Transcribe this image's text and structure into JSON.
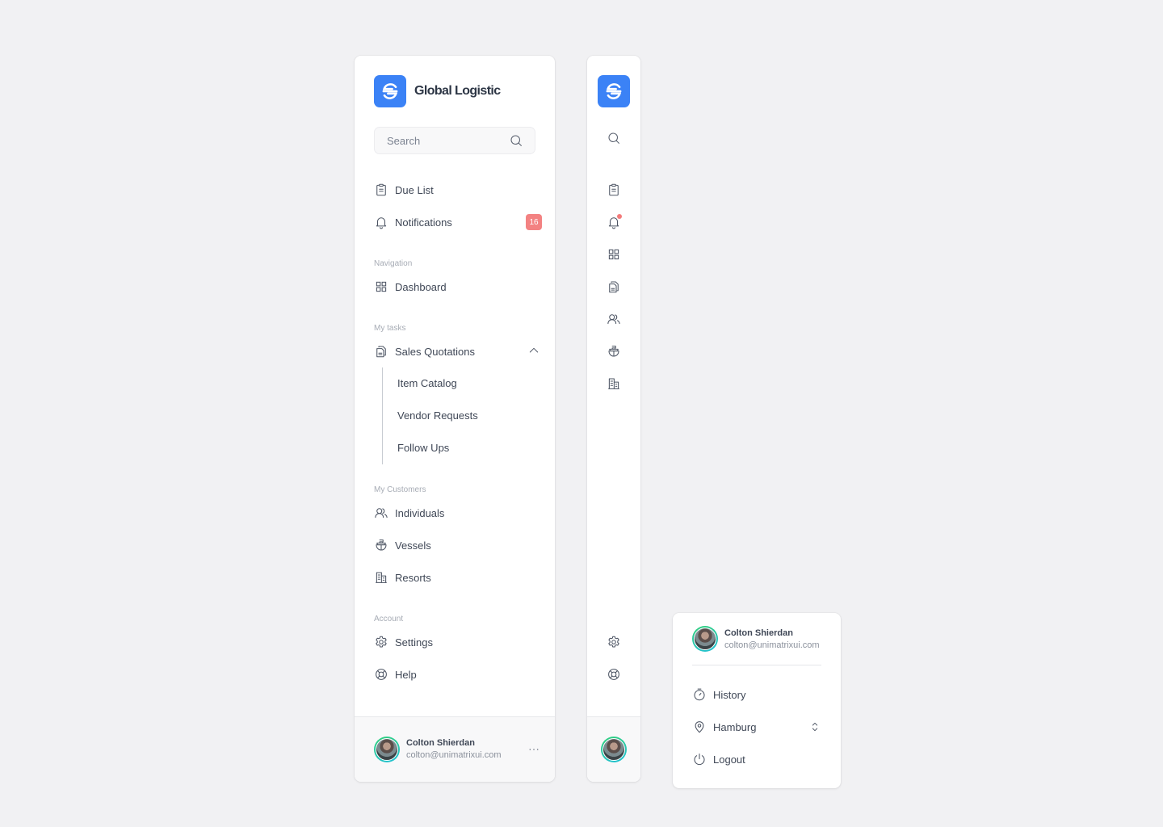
{
  "brand": {
    "name": "Global Logistic",
    "accent": "#3b82f6"
  },
  "search": {
    "placeholder": "Search",
    "value": ""
  },
  "top_items": [
    {
      "label": "Due List",
      "icon": "clipboard-icon"
    },
    {
      "label": "Notifications",
      "icon": "bell-icon",
      "badge": "16"
    }
  ],
  "sections": {
    "navigation": {
      "label": "Navigation",
      "items": [
        {
          "label": "Dashboard",
          "icon": "grid-icon"
        }
      ]
    },
    "my_tasks": {
      "label": "My tasks",
      "items": [
        {
          "label": "Sales Quotations",
          "icon": "documents-icon",
          "expanded": true
        }
      ],
      "sub_items": [
        {
          "label": "Item Catalog"
        },
        {
          "label": "Vendor Requests"
        },
        {
          "label": "Follow Ups"
        }
      ]
    },
    "my_customers": {
      "label": "My Customers",
      "items": [
        {
          "label": "Individuals",
          "icon": "users-icon"
        },
        {
          "label": "Vessels",
          "icon": "ship-icon"
        },
        {
          "label": "Resorts",
          "icon": "buildings-icon"
        }
      ]
    },
    "account": {
      "label": "Account",
      "items": [
        {
          "label": "Settings",
          "icon": "gear-icon"
        },
        {
          "label": "Help",
          "icon": "lifebuoy-icon"
        }
      ]
    }
  },
  "user": {
    "name": "Colton Shierdan",
    "email": "colton@unimatrixui.com"
  },
  "popover": {
    "items": [
      {
        "label": "History",
        "icon": "stopwatch-icon"
      },
      {
        "label": "Hamburg",
        "icon": "location-pin-icon",
        "selector": true
      },
      {
        "label": "Logout",
        "icon": "power-icon"
      }
    ]
  },
  "colors": {
    "badge": "#f38282",
    "notification_dot": "#f37a7a",
    "avatar_ring": "#34d07a"
  }
}
